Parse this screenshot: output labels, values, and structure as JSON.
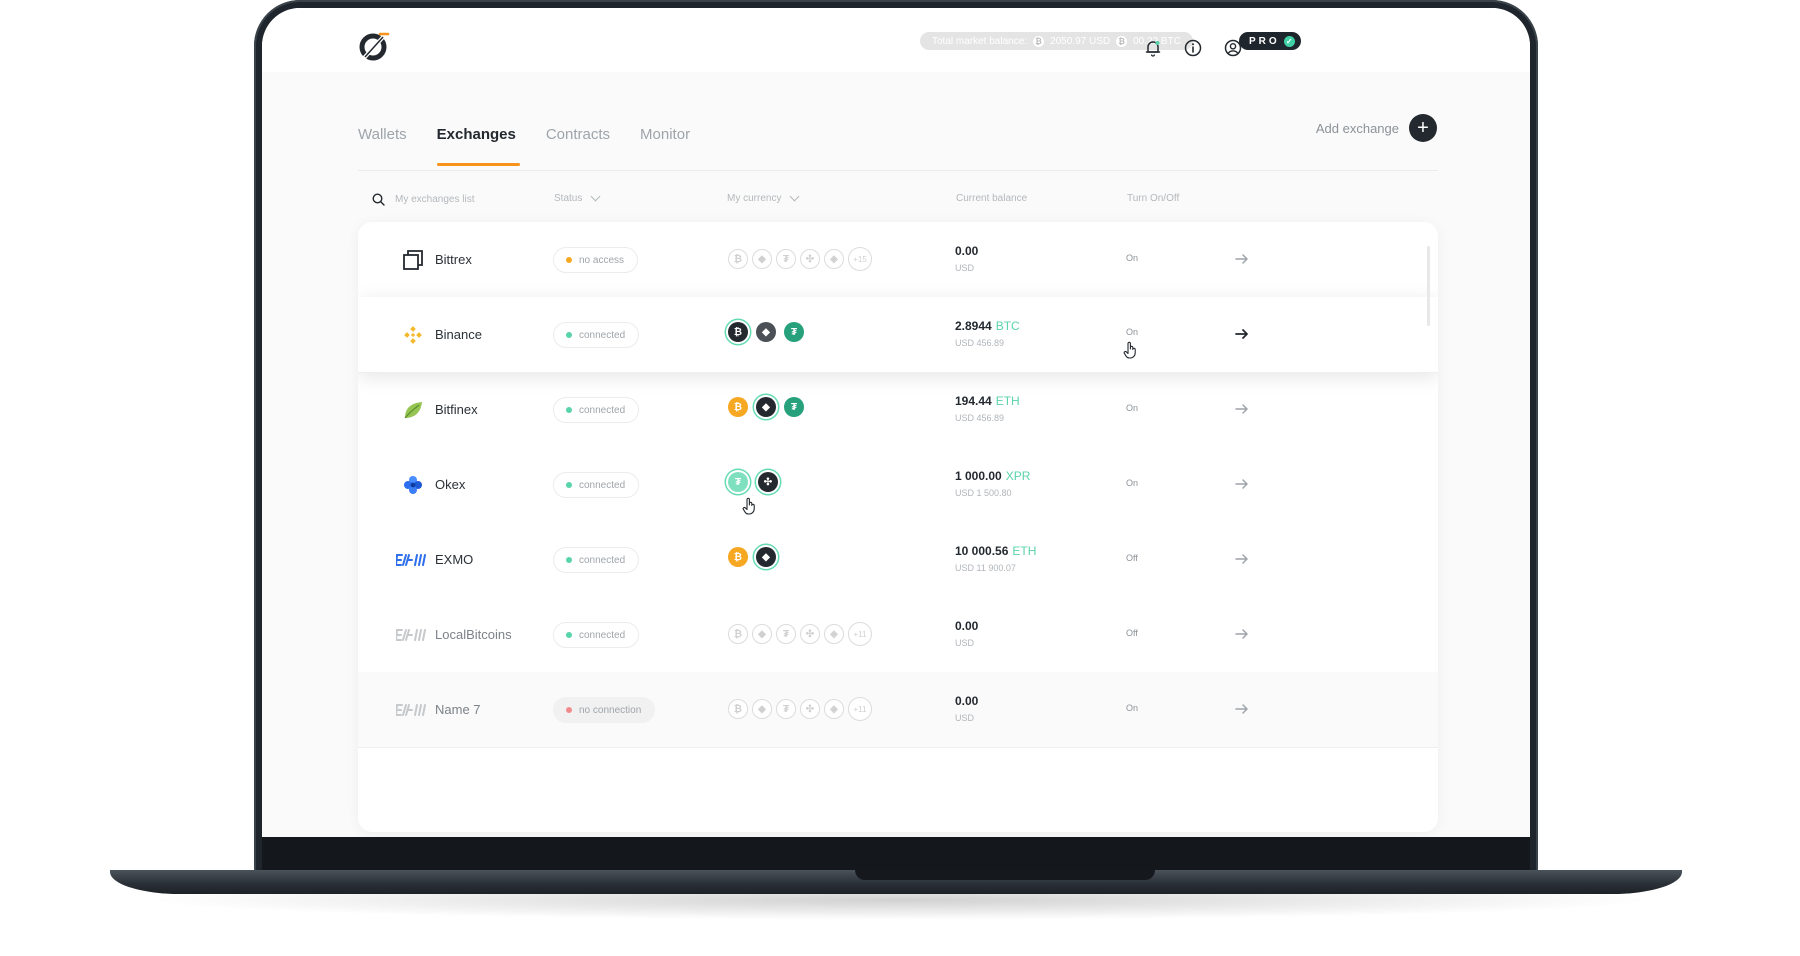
{
  "topbar": {
    "market_label": "Total market balance:",
    "usd_value": "2050.97 USD",
    "btc_value": "00.22 BTC",
    "pro_label": "PRO"
  },
  "tabs": [
    {
      "label": "Wallets",
      "active": false
    },
    {
      "label": "Exchanges",
      "active": true
    },
    {
      "label": "Contracts",
      "active": false
    },
    {
      "label": "Monitor",
      "active": false
    }
  ],
  "add_exchange_label": "Add exchange",
  "columns": {
    "search_placeholder": "My exchanges list",
    "status": "Status",
    "currency": "My currency",
    "balance": "Current balance",
    "toggle": "Turn On/Off"
  },
  "exchanges": [
    {
      "name": "Bittrex",
      "status": "no access",
      "status_color": "#f7a823",
      "balance": "0.00",
      "balance_currency": "",
      "sub": "USD",
      "toggle": "On"
    },
    {
      "name": "Binance",
      "status": "connected",
      "status_color": "#58d4a9",
      "balance": "2.8944",
      "balance_currency": "BTC",
      "sub": "USD 456.89",
      "toggle": "On"
    },
    {
      "name": "Bitfinex",
      "status": "connected",
      "status_color": "#58d4a9",
      "balance": "194.44",
      "balance_currency": "ETH",
      "sub": "USD 456.89",
      "toggle": "On"
    },
    {
      "name": "Okex",
      "status": "connected",
      "status_color": "#58d4a9",
      "balance": "1 000.00",
      "balance_currency": "XPR",
      "sub": "USD 1 500.80",
      "toggle": "On"
    },
    {
      "name": "EXMO",
      "status": "connected",
      "status_color": "#58d4a9",
      "balance": "10 000.56",
      "balance_currency": "ETH",
      "sub": "USD 11 900.07",
      "toggle": "Off"
    },
    {
      "name": "LocalBitcoins",
      "status": "connected",
      "status_color": "#58d4a9",
      "balance": "0.00",
      "balance_currency": "",
      "sub": "USD",
      "toggle": "Off"
    },
    {
      "name": "Name 7",
      "status": "no connection",
      "status_color": "#f28b8b",
      "balance": "0.00",
      "balance_currency": "",
      "sub": "USD",
      "toggle": "On"
    }
  ],
  "more_counts": {
    "bittrex": "+15",
    "localbitcoins": "+11",
    "name7": "+11"
  },
  "colors": {
    "accent": "#f7931a",
    "green": "#58d4a9",
    "dark": "#23292f"
  }
}
